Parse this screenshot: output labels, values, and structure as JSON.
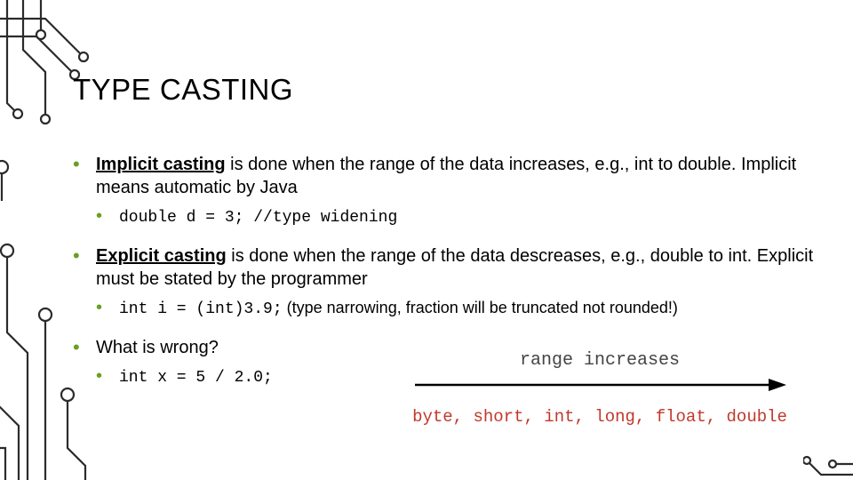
{
  "title": "TYPE CASTING",
  "bullets": {
    "implicit": {
      "lead_bold": "Implicit casting",
      "lead_rest": " is done when the range of the data increases, e.g., int to double. Implicit means automatic by Java",
      "sub_code": "double d = 3; //type widening"
    },
    "explicit": {
      "lead_bold": "Explicit casting",
      "lead_rest": " is done when the range of the data descreases, e.g., double to int. Explicit must be stated by the programmer",
      "sub_code": "int i = (int)3.9;",
      "sub_note": " (type narrowing, fraction will be truncated not rounded!)"
    },
    "question": {
      "text": "What is wrong?",
      "sub_code": "int x = 5 / 2.0;"
    }
  },
  "diagram": {
    "label": "range increases",
    "types": "byte, short, int, long, float, double"
  }
}
